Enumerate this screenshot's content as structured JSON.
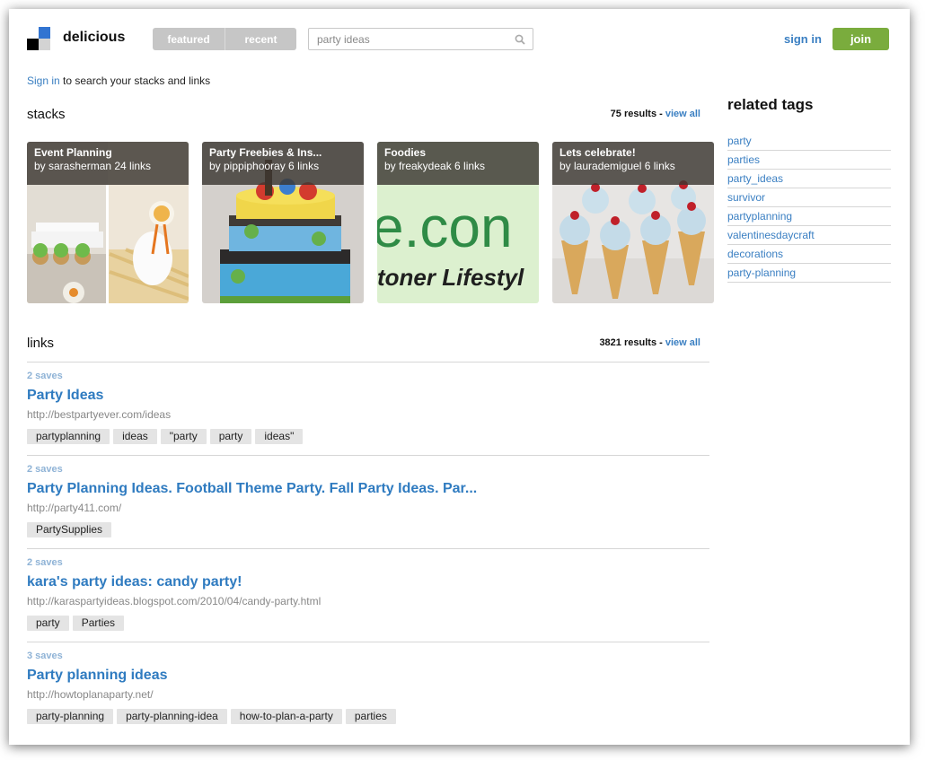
{
  "header": {
    "brand": "delicious",
    "tabs": [
      {
        "label": "featured"
      },
      {
        "label": "recent"
      }
    ],
    "search_value": "party ideas",
    "sign_in": "sign in",
    "join": "join"
  },
  "hint": {
    "link": "Sign in",
    "text": " to search your stacks and links"
  },
  "stacks": {
    "title": "stacks",
    "count": "75",
    "results_label": "results",
    "sep": "-",
    "view_all": "view all",
    "items": [
      {
        "title": "Event Planning",
        "by": "by sarasherman 24 links"
      },
      {
        "title": "Party Freebies & Ins...",
        "by": "by pippiphooray 6 links"
      },
      {
        "title": "Foodies",
        "by": "by freakydeak 6 links"
      },
      {
        "title": "Lets celebrate!",
        "by": "by laurademiguel 6 links"
      }
    ],
    "foodies_image_text": {
      "big": "e.con",
      "small": "toner Lifestyl"
    }
  },
  "links": {
    "title": "links",
    "count": "3821",
    "results_label": "results",
    "sep": "-",
    "view_all": "view all",
    "items": [
      {
        "saves": "2 saves",
        "title": "Party Ideas",
        "url": "http://bestpartyever.com/ideas",
        "tags": [
          "partyplanning",
          "ideas",
          "\"party",
          "party",
          "ideas\""
        ]
      },
      {
        "saves": "2 saves",
        "title": "Party Planning Ideas. Football Theme Party. Fall Party Ideas. Par...",
        "url": "http://party411.com/",
        "tags": [
          "PartySupplies"
        ]
      },
      {
        "saves": "2 saves",
        "title": "kara's party ideas: candy party!",
        "url": "http://karaspartyideas.blogspot.com/2010/04/candy-party.html",
        "tags": [
          "party",
          "Parties"
        ]
      },
      {
        "saves": "3 saves",
        "title": "Party planning ideas",
        "url": "http://howtoplanaparty.net/",
        "tags": [
          "party-planning",
          "party-planning-idea",
          "how-to-plan-a-party",
          "parties"
        ]
      }
    ]
  },
  "related": {
    "title": "related tags",
    "items": [
      "party",
      "parties",
      "party_ideas",
      "survivor",
      "partyplanning",
      "valentinesdaycraft",
      "decorations",
      "party-planning"
    ]
  },
  "colors": {
    "link": "#3a7fc2",
    "join": "#7aac3d",
    "logo_blue": "#3274d1"
  }
}
